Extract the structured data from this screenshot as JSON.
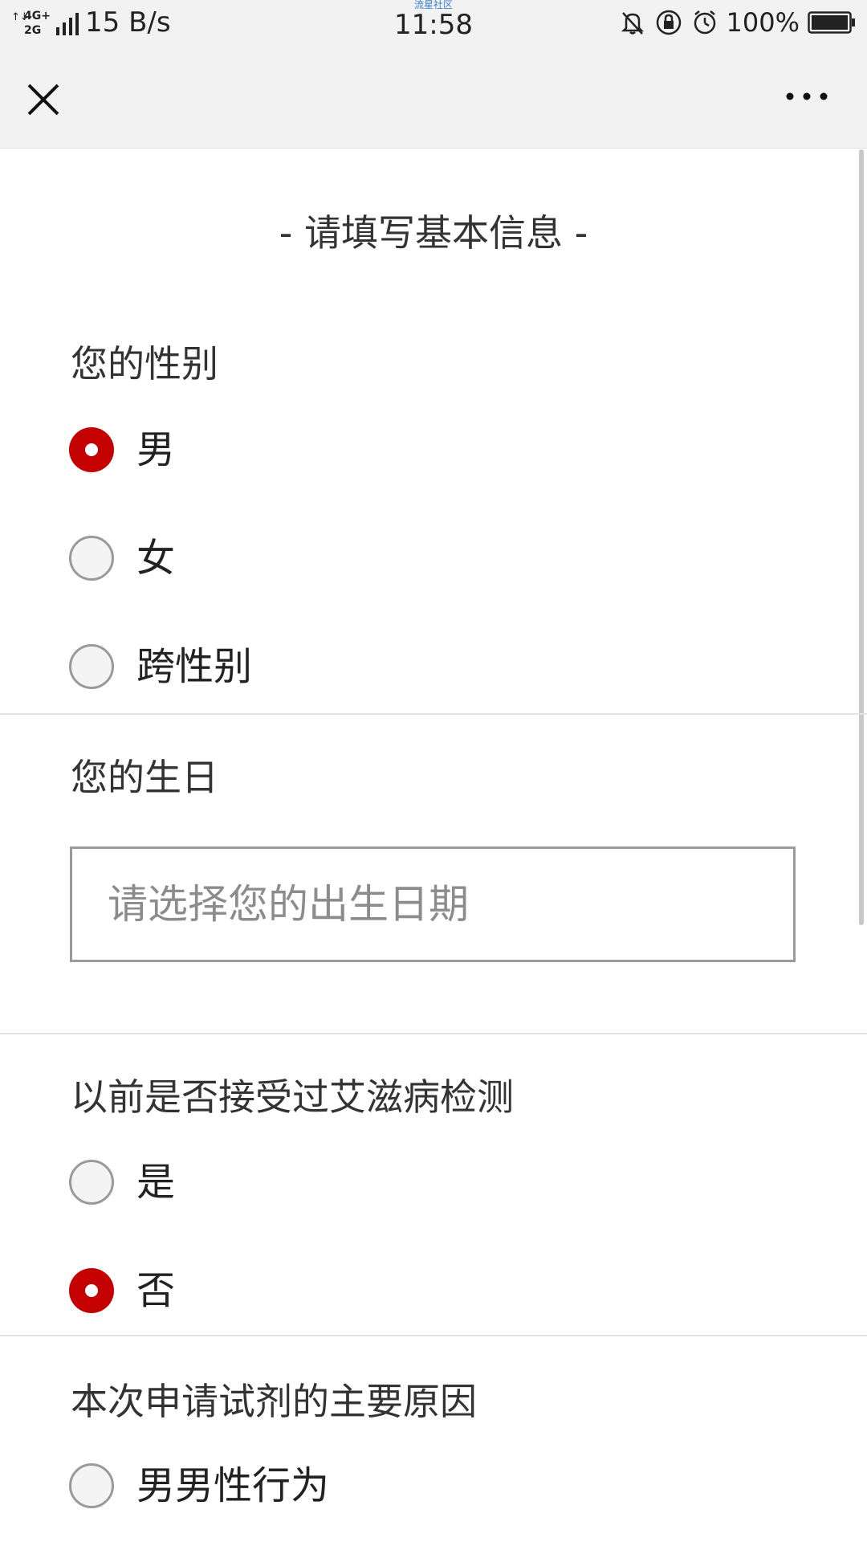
{
  "status_bar": {
    "network": "4G+ 2G",
    "speed": "15 B/s",
    "carrier_label": "流星社区",
    "time": "11:58",
    "battery": "100%"
  },
  "nav": {
    "close_icon": "close-icon",
    "more_icon": "more-icon"
  },
  "form": {
    "title": "- 请填写基本信息 -",
    "gender": {
      "label": "您的性别",
      "options": [
        "男",
        "女",
        "跨性别"
      ],
      "selected": "男"
    },
    "birthday": {
      "label": "您的生日",
      "placeholder": "请选择您的出生日期"
    },
    "hiv_test": {
      "label": "以前是否接受过艾滋病检测",
      "options": [
        "是",
        "否"
      ],
      "selected": "否"
    },
    "reason": {
      "label": "本次申请试剂的主要原因",
      "options": [
        "男男性行为"
      ]
    }
  },
  "colors": {
    "accent": "#c40000",
    "bar_background": "#f2f2f2",
    "placeholder": "#8c8c8c"
  }
}
